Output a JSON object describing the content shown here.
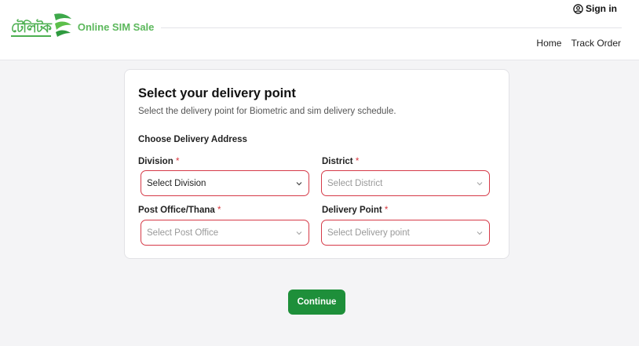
{
  "header": {
    "logo_bangla": "টেলিটক",
    "brand_name": "Online SIM Sale",
    "sign_in_label": "Sign in",
    "nav": [
      {
        "label": "Home"
      },
      {
        "label": "Track Order"
      }
    ]
  },
  "card": {
    "title": "Select your delivery point",
    "subtitle": "Select the delivery point for Biometric and sim delivery schedule.",
    "section_label": "Choose Delivery Address",
    "fields": {
      "division": {
        "label": "Division",
        "required": "*",
        "value": "Select Division"
      },
      "district": {
        "label": "District",
        "required": "*",
        "value": "Select District"
      },
      "post_office": {
        "label": "Post Office/Thana",
        "required": "*",
        "value": "Select Post Office"
      },
      "delivery_point": {
        "label": "Delivery Point",
        "required": "*",
        "value": "Select Delivery point"
      }
    }
  },
  "actions": {
    "continue_label": "Continue"
  },
  "colors": {
    "brand_green": "#1e8f3a",
    "logo_green": "#5cb85c",
    "error_red": "#d63a48"
  }
}
